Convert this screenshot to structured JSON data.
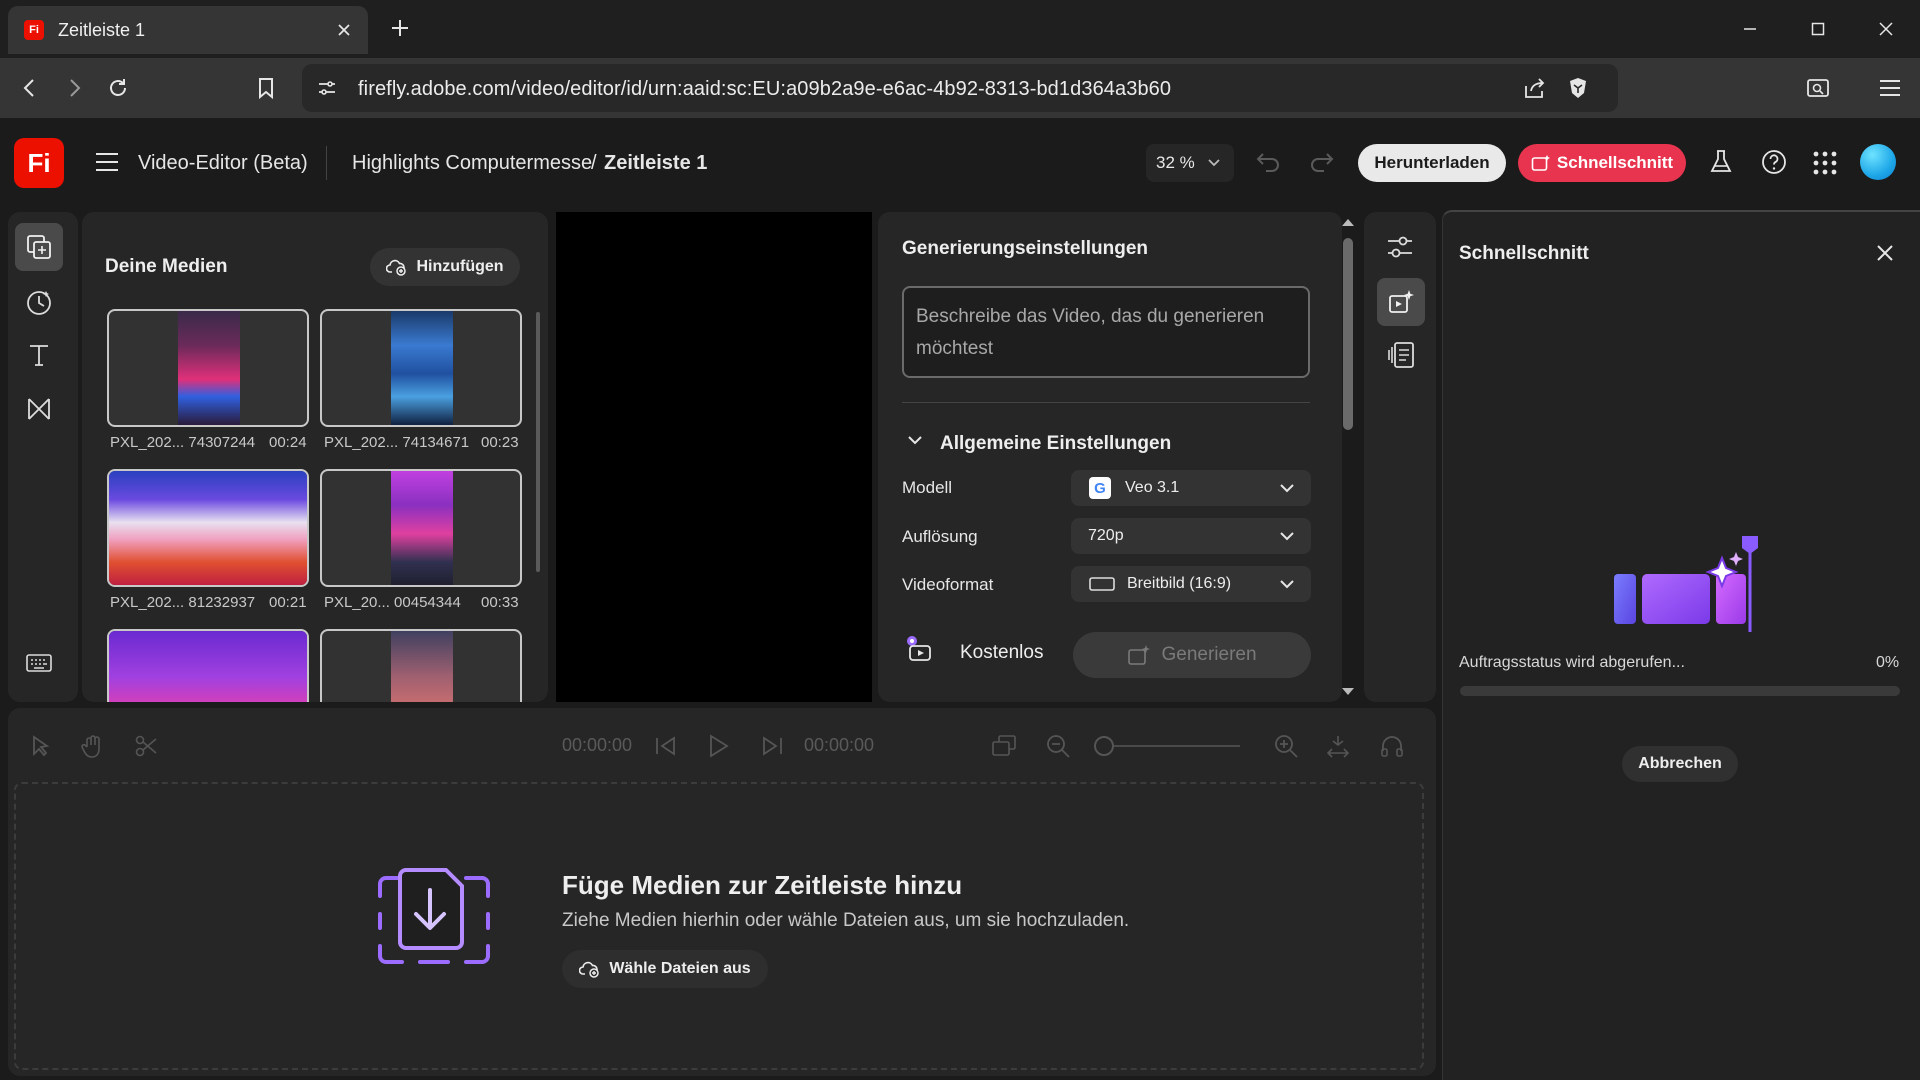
{
  "browser": {
    "tab_title": "Zeitleiste 1",
    "url": "firefly.adobe.com/video/editor/id/urn:aaid:sc:EU:a09b2a9e-e6ac-4b92-8313-bd1d364a3b60"
  },
  "app": {
    "logo": "Fi",
    "name": "Video-Editor (Beta)",
    "project": "Highlights Computermesse",
    "separator": "/",
    "timeline_name": "Zeitleiste 1",
    "zoom": "32 %",
    "download_label": "Herunterladen",
    "quickcut_label": "Schnellschnitt"
  },
  "media": {
    "title": "Deine Medien",
    "add_label": "Hinzufügen",
    "items": [
      {
        "name": "PXL_202... 74307244",
        "duration": "00:24"
      },
      {
        "name": "PXL_202... 74134671",
        "duration": "00:23"
      },
      {
        "name": "PXL_202... 81232937",
        "duration": "00:21"
      },
      {
        "name": "PXL_20... 00454344",
        "duration": "00:33"
      },
      {
        "name": "",
        "duration": ""
      },
      {
        "name": "",
        "duration": ""
      }
    ]
  },
  "generation": {
    "title": "Generierungseinstellungen",
    "prompt_placeholder": "Beschreibe das Video, das du generieren möchtest",
    "section_title": "Allgemeine Einstellungen",
    "model_label": "Modell",
    "model_value": "Veo 3.1",
    "resolution_label": "Auflösung",
    "resolution_value": "720p",
    "format_label": "Videoformat",
    "format_value": "Breitbild (16:9)",
    "cost_label": "Kostenlos",
    "generate_label": "Generieren"
  },
  "quickcut": {
    "title": "Schnellschnitt",
    "status": "Auftragsstatus wird abgerufen...",
    "percent": "0%",
    "progress": 0,
    "cancel_label": "Abbrechen"
  },
  "timeline": {
    "time_current": "00:00:00",
    "time_total": "00:00:00",
    "empty_title": "Füge Medien zur Zeitleiste hinzu",
    "empty_subtitle": "Ziehe Medien hierhin oder wähle Dateien aus, um sie hochzuladen.",
    "choose_files_label": "Wähle Dateien aus"
  },
  "colors": {
    "brand_red": "#eb1000",
    "quickcut_pill": "#e8344e",
    "accent_purple": "#9b6cff"
  }
}
